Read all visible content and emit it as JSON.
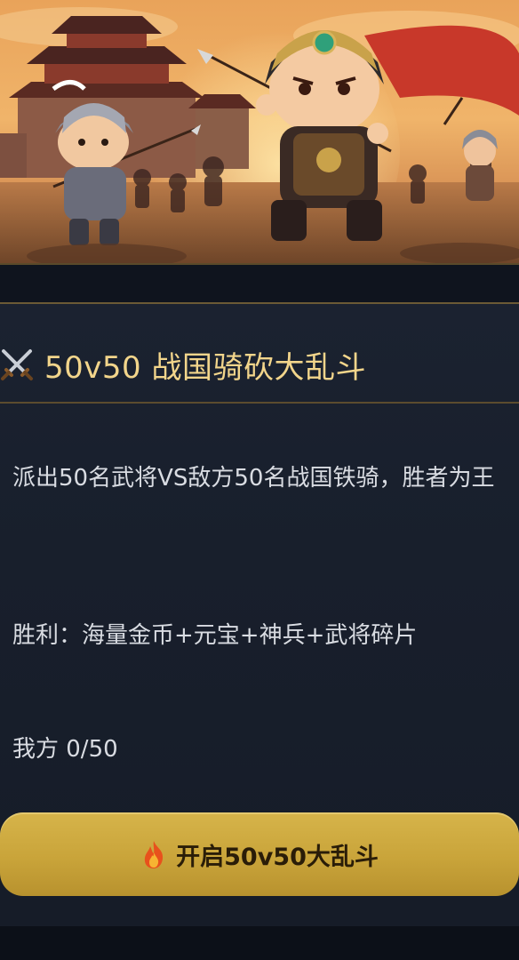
{
  "event": {
    "title": "50v50 战国骑砍大乱斗",
    "description": "派出50名武将VS敌方50名战国铁骑，胜者为王",
    "reward": "胜利：海量金币+元宝+神兵+武将碎片",
    "count": "我方 0/50",
    "title_icon": "crossed-swords-icon"
  },
  "actions": {
    "start_label": "开启50v50大乱斗",
    "start_icon": "fire-icon"
  },
  "colors": {
    "title": "#f2d58b",
    "body_text": "#d9dce2",
    "button": "#c9a43a",
    "card_bg": "#1b2230"
  }
}
